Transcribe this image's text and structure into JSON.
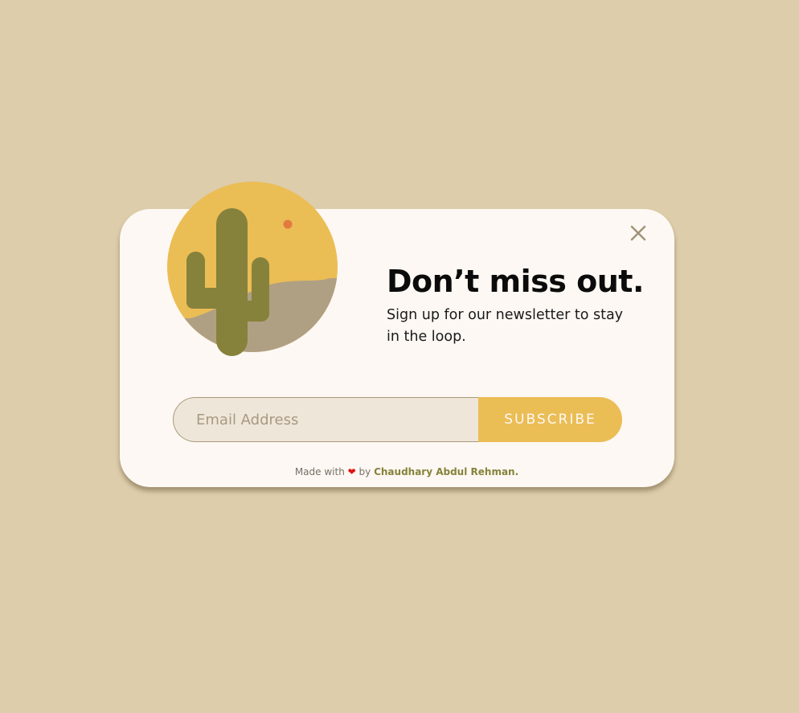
{
  "popup": {
    "headline": "Don’t miss out.",
    "subtext": "Sign up for our newsletter to stay in the loop.",
    "illustration_icon": "cactus-desert-icon",
    "close_icon": "close-icon"
  },
  "form": {
    "email_placeholder": "Email Address",
    "email_value": "",
    "subscribe_label": "SUBSCRIBE"
  },
  "footer": {
    "made_with": "Made with",
    "heart_icon": "heart-icon",
    "by": "by",
    "author": "Chaudhary Abdul Rehman."
  },
  "colors": {
    "page_background": "#ddcdab",
    "card_background": "#fdf8f3",
    "sun_yellow": "#ebbd55",
    "cactus_green": "#86823b",
    "sand": "#b0a083",
    "sun_dot": "#e27a3f",
    "heart_red": "#e01414"
  }
}
